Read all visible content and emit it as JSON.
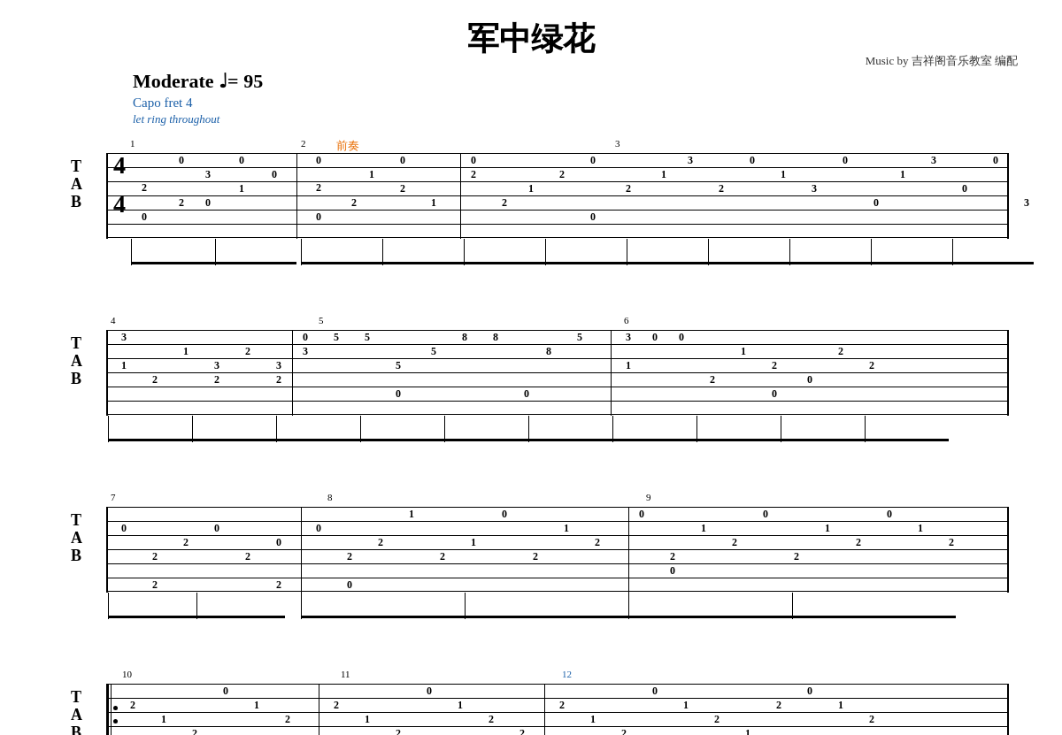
{
  "title": "军中绿花",
  "credit": "Music by 吉祥阁音乐教室  编配",
  "tempo": {
    "label": "Moderate ♩= 95"
  },
  "capo": "Capo fret 4",
  "let_ring": "let ring throughout",
  "time_signature": "4/4",
  "section_label": "前奏",
  "measures": [
    {
      "number": 1
    },
    {
      "number": 2
    },
    {
      "number": 3
    },
    {
      "number": 4
    },
    {
      "number": 5
    },
    {
      "number": 6
    },
    {
      "number": 7
    },
    {
      "number": 8
    },
    {
      "number": 9
    },
    {
      "number": 10
    },
    {
      "number": 11
    },
    {
      "number": 12
    }
  ]
}
